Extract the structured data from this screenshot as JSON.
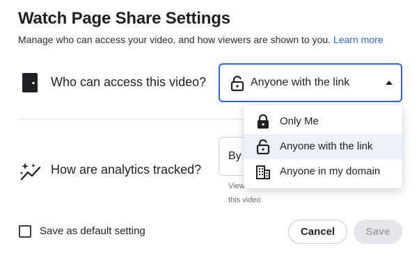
{
  "dialog": {
    "title": "Watch Page Share Settings",
    "subtitle": "Manage who can access your video, and how viewers are shown to you.",
    "learn_more": "Learn more"
  },
  "access": {
    "question": "Who can access this video?",
    "selected_value": "Anyone with the link",
    "icon": "lock-icon",
    "options": [
      {
        "label": "Only Me",
        "icon": "lock-closed-icon",
        "selected": false
      },
      {
        "label": "Anyone with the link",
        "icon": "lock-open-icon",
        "selected": true
      },
      {
        "label": "Anyone in my domain",
        "icon": "building-icon",
        "selected": false
      }
    ]
  },
  "analytics": {
    "question": "How are analytics tracked?",
    "selected_value_visible": "By",
    "helper_line1": "View",
    "helper_line2": "this video",
    "icon": "sparkle-chart-icon"
  },
  "footer": {
    "default_checkbox_label": "Save as default setting",
    "default_checked": false,
    "cancel_label": "Cancel",
    "save_label": "Save"
  },
  "colors": {
    "accent": "#2f63d6",
    "selected_bg": "#ecf1fb",
    "disabled_bg": "#e6e6ea",
    "disabled_text": "#a5a5ad"
  }
}
